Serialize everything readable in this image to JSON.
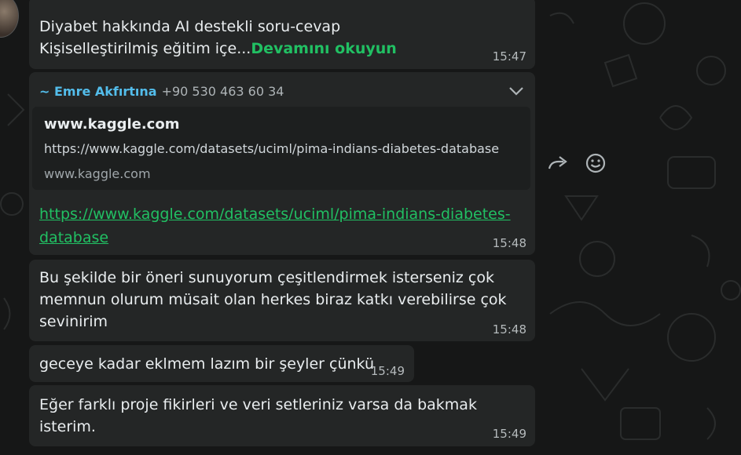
{
  "messages": [
    {
      "line1": "Diyabet hakkında AI destekli soru-cevap",
      "line2": "Kişiselleştirilmiş eğitim içe...",
      "read_more": "Devamını okuyun",
      "time": "15:47"
    },
    {
      "sender_name": "~ Emre Akfırtına",
      "sender_phone": "+90 530 463 60 34",
      "preview_title": "www.kaggle.com",
      "preview_description": "https://www.kaggle.com/datasets/uciml/pima-indians-diabetes-database",
      "preview_domain": "www.kaggle.com",
      "url_line1": "https://www.kaggle.com/datasets/uciml/pima-indians-diabetes-",
      "url_line2": "database",
      "time": "15:48"
    },
    {
      "line1": "Bu şekilde bir öneri sunuyorum çeşitlendirmek isterseniz çok",
      "line2": "memnun olurum müsait olan herkes biraz katkı verebilirse çok",
      "line3": "sevinirim",
      "time": "15:48"
    },
    {
      "text": "geceye kadar eklmem lazım bir şeyler çünkü",
      "time": "15:49"
    },
    {
      "text": "Eğer farklı proje fikirleri ve veri setleriniz varsa da bakmak isterim.",
      "time": "15:49"
    }
  ],
  "icons": {
    "forward": "forward-icon",
    "react": "emoji-icon",
    "menu": "chevron-down-icon"
  },
  "colors": {
    "background": "#161717",
    "bubble": "#242626",
    "link": "#21c063",
    "sender": "#53bdeb"
  }
}
